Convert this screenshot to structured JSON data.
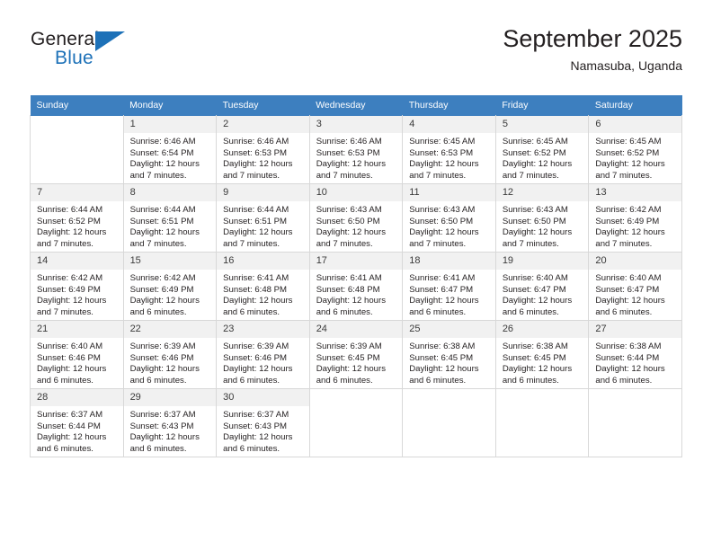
{
  "logo": {
    "word_top": "General",
    "word_bottom": "Blue",
    "accent_color": "#1d71b8",
    "triangle_icon": "triangle-icon"
  },
  "header": {
    "title": "September 2025",
    "subtitle": "Namasuba, Uganda"
  },
  "theme": {
    "header_row_bg": "#3d7fbf",
    "daynum_bg": "#f1f1f1",
    "grid_line": "#d8d8d8",
    "text": "#231f20"
  },
  "weekday_headers": [
    "Sunday",
    "Monday",
    "Tuesday",
    "Wednesday",
    "Thursday",
    "Friday",
    "Saturday"
  ],
  "weeks": [
    [
      {
        "day": "",
        "sunrise": "",
        "sunset": "",
        "daylight": "",
        "empty": true
      },
      {
        "day": "1",
        "sunrise": "Sunrise: 6:46 AM",
        "sunset": "Sunset: 6:54 PM",
        "daylight": "Daylight: 12 hours and 7 minutes."
      },
      {
        "day": "2",
        "sunrise": "Sunrise: 6:46 AM",
        "sunset": "Sunset: 6:53 PM",
        "daylight": "Daylight: 12 hours and 7 minutes."
      },
      {
        "day": "3",
        "sunrise": "Sunrise: 6:46 AM",
        "sunset": "Sunset: 6:53 PM",
        "daylight": "Daylight: 12 hours and 7 minutes."
      },
      {
        "day": "4",
        "sunrise": "Sunrise: 6:45 AM",
        "sunset": "Sunset: 6:53 PM",
        "daylight": "Daylight: 12 hours and 7 minutes."
      },
      {
        "day": "5",
        "sunrise": "Sunrise: 6:45 AM",
        "sunset": "Sunset: 6:52 PM",
        "daylight": "Daylight: 12 hours and 7 minutes."
      },
      {
        "day": "6",
        "sunrise": "Sunrise: 6:45 AM",
        "sunset": "Sunset: 6:52 PM",
        "daylight": "Daylight: 12 hours and 7 minutes."
      }
    ],
    [
      {
        "day": "7",
        "sunrise": "Sunrise: 6:44 AM",
        "sunset": "Sunset: 6:52 PM",
        "daylight": "Daylight: 12 hours and 7 minutes."
      },
      {
        "day": "8",
        "sunrise": "Sunrise: 6:44 AM",
        "sunset": "Sunset: 6:51 PM",
        "daylight": "Daylight: 12 hours and 7 minutes."
      },
      {
        "day": "9",
        "sunrise": "Sunrise: 6:44 AM",
        "sunset": "Sunset: 6:51 PM",
        "daylight": "Daylight: 12 hours and 7 minutes."
      },
      {
        "day": "10",
        "sunrise": "Sunrise: 6:43 AM",
        "sunset": "Sunset: 6:50 PM",
        "daylight": "Daylight: 12 hours and 7 minutes."
      },
      {
        "day": "11",
        "sunrise": "Sunrise: 6:43 AM",
        "sunset": "Sunset: 6:50 PM",
        "daylight": "Daylight: 12 hours and 7 minutes."
      },
      {
        "day": "12",
        "sunrise": "Sunrise: 6:43 AM",
        "sunset": "Sunset: 6:50 PM",
        "daylight": "Daylight: 12 hours and 7 minutes."
      },
      {
        "day": "13",
        "sunrise": "Sunrise: 6:42 AM",
        "sunset": "Sunset: 6:49 PM",
        "daylight": "Daylight: 12 hours and 7 minutes."
      }
    ],
    [
      {
        "day": "14",
        "sunrise": "Sunrise: 6:42 AM",
        "sunset": "Sunset: 6:49 PM",
        "daylight": "Daylight: 12 hours and 7 minutes."
      },
      {
        "day": "15",
        "sunrise": "Sunrise: 6:42 AM",
        "sunset": "Sunset: 6:49 PM",
        "daylight": "Daylight: 12 hours and 6 minutes."
      },
      {
        "day": "16",
        "sunrise": "Sunrise: 6:41 AM",
        "sunset": "Sunset: 6:48 PM",
        "daylight": "Daylight: 12 hours and 6 minutes."
      },
      {
        "day": "17",
        "sunrise": "Sunrise: 6:41 AM",
        "sunset": "Sunset: 6:48 PM",
        "daylight": "Daylight: 12 hours and 6 minutes."
      },
      {
        "day": "18",
        "sunrise": "Sunrise: 6:41 AM",
        "sunset": "Sunset: 6:47 PM",
        "daylight": "Daylight: 12 hours and 6 minutes."
      },
      {
        "day": "19",
        "sunrise": "Sunrise: 6:40 AM",
        "sunset": "Sunset: 6:47 PM",
        "daylight": "Daylight: 12 hours and 6 minutes."
      },
      {
        "day": "20",
        "sunrise": "Sunrise: 6:40 AM",
        "sunset": "Sunset: 6:47 PM",
        "daylight": "Daylight: 12 hours and 6 minutes."
      }
    ],
    [
      {
        "day": "21",
        "sunrise": "Sunrise: 6:40 AM",
        "sunset": "Sunset: 6:46 PM",
        "daylight": "Daylight: 12 hours and 6 minutes."
      },
      {
        "day": "22",
        "sunrise": "Sunrise: 6:39 AM",
        "sunset": "Sunset: 6:46 PM",
        "daylight": "Daylight: 12 hours and 6 minutes."
      },
      {
        "day": "23",
        "sunrise": "Sunrise: 6:39 AM",
        "sunset": "Sunset: 6:46 PM",
        "daylight": "Daylight: 12 hours and 6 minutes."
      },
      {
        "day": "24",
        "sunrise": "Sunrise: 6:39 AM",
        "sunset": "Sunset: 6:45 PM",
        "daylight": "Daylight: 12 hours and 6 minutes."
      },
      {
        "day": "25",
        "sunrise": "Sunrise: 6:38 AM",
        "sunset": "Sunset: 6:45 PM",
        "daylight": "Daylight: 12 hours and 6 minutes."
      },
      {
        "day": "26",
        "sunrise": "Sunrise: 6:38 AM",
        "sunset": "Sunset: 6:45 PM",
        "daylight": "Daylight: 12 hours and 6 minutes."
      },
      {
        "day": "27",
        "sunrise": "Sunrise: 6:38 AM",
        "sunset": "Sunset: 6:44 PM",
        "daylight": "Daylight: 12 hours and 6 minutes."
      }
    ],
    [
      {
        "day": "28",
        "sunrise": "Sunrise: 6:37 AM",
        "sunset": "Sunset: 6:44 PM",
        "daylight": "Daylight: 12 hours and 6 minutes."
      },
      {
        "day": "29",
        "sunrise": "Sunrise: 6:37 AM",
        "sunset": "Sunset: 6:43 PM",
        "daylight": "Daylight: 12 hours and 6 minutes."
      },
      {
        "day": "30",
        "sunrise": "Sunrise: 6:37 AM",
        "sunset": "Sunset: 6:43 PM",
        "daylight": "Daylight: 12 hours and 6 minutes."
      },
      {
        "day": "",
        "sunrise": "",
        "sunset": "",
        "daylight": "",
        "empty": true
      },
      {
        "day": "",
        "sunrise": "",
        "sunset": "",
        "daylight": "",
        "empty": true
      },
      {
        "day": "",
        "sunrise": "",
        "sunset": "",
        "daylight": "",
        "empty": true
      },
      {
        "day": "",
        "sunrise": "",
        "sunset": "",
        "daylight": "",
        "empty": true
      }
    ]
  ]
}
